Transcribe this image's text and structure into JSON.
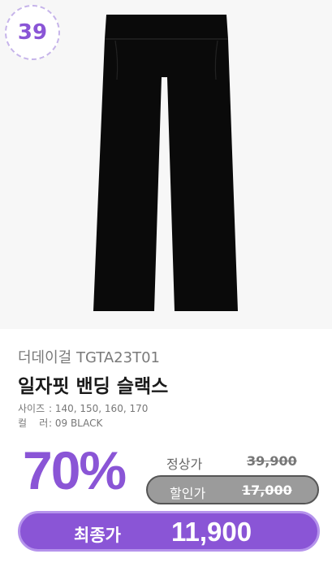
{
  "badge": {
    "number": "39"
  },
  "product": {
    "image_icon": "black-pants-image",
    "brand": "더데이걸 TGTA23T01",
    "title": "일자핏 밴딩 슬랙스",
    "size_label": "사이즈",
    "size_value": ": 140, 150, 160, 170",
    "color_label": "컬    러",
    "color_value": ": 09 BLACK"
  },
  "pricing": {
    "discount": "70%",
    "regular_label": "정상가",
    "regular_price": "39,900",
    "sale_label": "할인가",
    "sale_price": "17,000",
    "final_label": "최종가",
    "final_price": "11,900"
  },
  "colors": {
    "accent": "#8a55d6",
    "accent_light": "#b593ec",
    "badge_border": "#c6b4ea",
    "image_bg": "#f7f7f7",
    "sale_pill": "#9b9b9b"
  }
}
